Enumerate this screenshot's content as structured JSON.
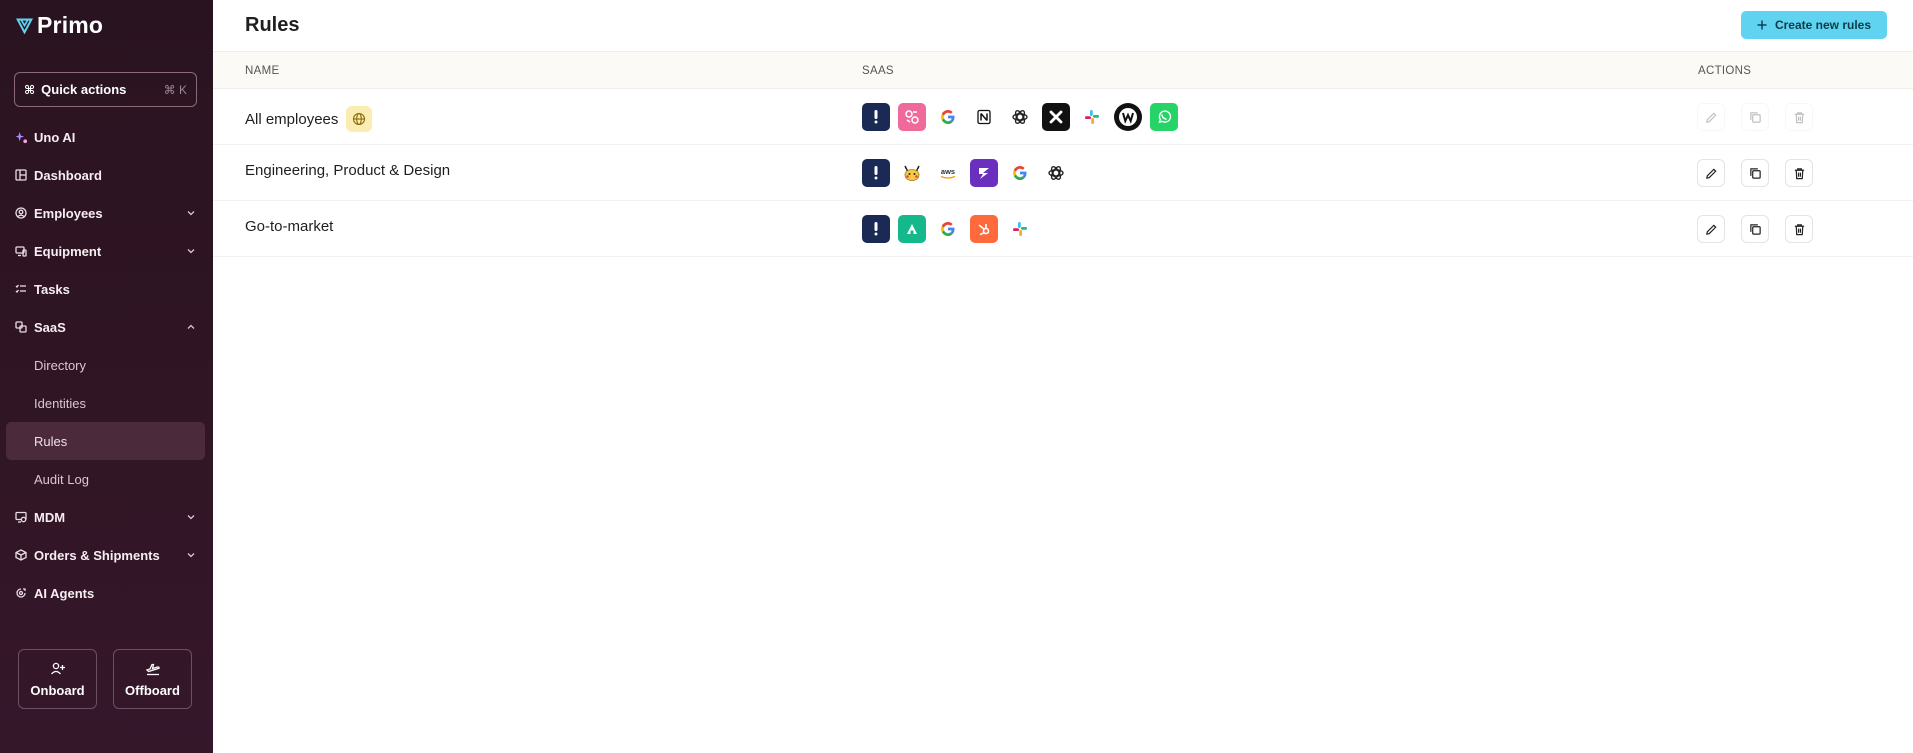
{
  "app": {
    "logo_text": "Primo"
  },
  "sidebar": {
    "quick_actions": {
      "label": "Quick actions",
      "shortcut": "⌘ K"
    },
    "items": [
      {
        "label": "Uno AI"
      },
      {
        "label": "Dashboard"
      },
      {
        "label": "Employees"
      },
      {
        "label": "Equipment"
      },
      {
        "label": "Tasks"
      },
      {
        "label": "SaaS"
      },
      {
        "label": "Directory"
      },
      {
        "label": "Identities"
      },
      {
        "label": "Rules"
      },
      {
        "label": "Audit Log"
      },
      {
        "label": "MDM"
      },
      {
        "label": "Orders & Shipments"
      },
      {
        "label": "AI Agents"
      }
    ],
    "bottom_actions": [
      {
        "label": "Onboard"
      },
      {
        "label": "Offboard"
      }
    ]
  },
  "header": {
    "title": "Rules",
    "create_button": "Create new rules"
  },
  "table": {
    "columns": {
      "name": "NAME",
      "saas": "SAAS",
      "actions": "ACTIONS"
    },
    "rows": [
      {
        "name": "All employees",
        "badge_icon": "globe-icon",
        "apps": [
          "1password",
          "miro-style",
          "google",
          "notion",
          "openai",
          "x-app",
          "slack",
          "w-app",
          "whatsapp"
        ],
        "actions_enabled": false
      },
      {
        "name": "Engineering, Product & Design",
        "apps": [
          "1password",
          "pokemon-app",
          "aws",
          "jira-purple",
          "google",
          "openai"
        ],
        "actions_enabled": true
      },
      {
        "name": "Go-to-market",
        "apps": [
          "1password",
          "green-a-app",
          "google",
          "hubspot",
          "slack"
        ],
        "actions_enabled": true
      }
    ]
  },
  "colors": {
    "accent": "#5fd3ef",
    "sidebar_bg": "#2f1524",
    "active_item": "#4a2a3b"
  }
}
